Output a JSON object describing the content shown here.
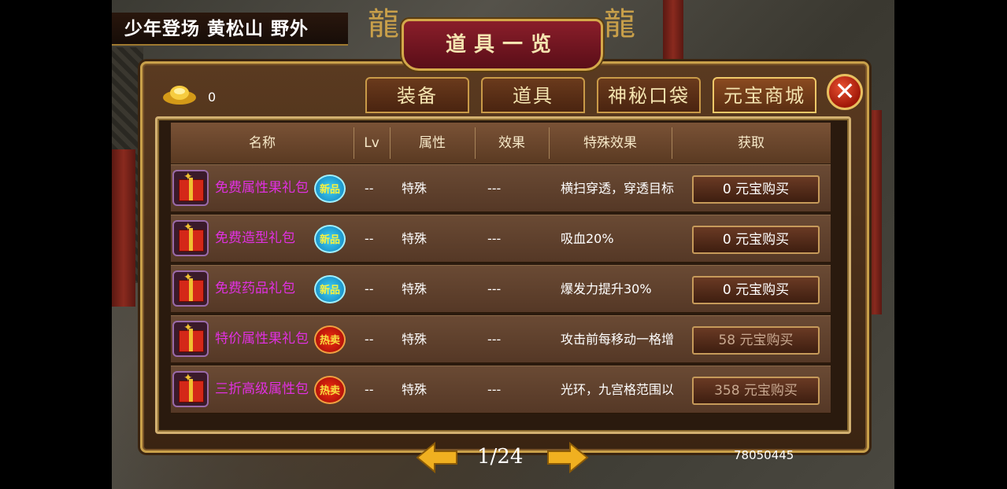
{
  "location": "少年登场 黄松山 野外",
  "window_title": "道具一览",
  "currency": {
    "icon": "gold-ingot-icon",
    "amount": "0"
  },
  "tabs": [
    {
      "label": "装备",
      "active": false
    },
    {
      "label": "道具",
      "active": false
    },
    {
      "label": "神秘口袋",
      "active": false
    },
    {
      "label": "元宝商城",
      "active": true
    }
  ],
  "close_label": "✕",
  "table": {
    "headers": [
      "名称",
      "Lv",
      "属性",
      "效果",
      "特殊效果",
      "获取"
    ],
    "rows": [
      {
        "name": "免费属性果礼包",
        "badge": "新品",
        "badge_type": "new",
        "lv": "--",
        "attr": "特殊",
        "effect": "---",
        "special": "横扫穿透，穿透目标",
        "buy": "0 元宝购买",
        "buy_enabled": true
      },
      {
        "name": "免费造型礼包",
        "badge": "新品",
        "badge_type": "new",
        "lv": "--",
        "attr": "特殊",
        "effect": "---",
        "special": "吸血20%",
        "buy": "0 元宝购买",
        "buy_enabled": true
      },
      {
        "name": "免费药品礼包",
        "badge": "新品",
        "badge_type": "new",
        "lv": "--",
        "attr": "特殊",
        "effect": "---",
        "special": "爆发力提升30%",
        "buy": "0 元宝购买",
        "buy_enabled": true
      },
      {
        "name": "特价属性果礼包",
        "badge": "热卖",
        "badge_type": "hot",
        "lv": "--",
        "attr": "特殊",
        "effect": "---",
        "special": "攻击前每移动一格增",
        "buy": "58 元宝购买",
        "buy_enabled": false
      },
      {
        "name": "三折高级属性包",
        "badge": "热卖",
        "badge_type": "hot",
        "lv": "--",
        "attr": "特殊",
        "effect": "---",
        "special": "光环，九宫格范围以",
        "buy": "358 元宝购买",
        "buy_enabled": false
      }
    ]
  },
  "pagination": {
    "current": "1/24"
  },
  "player_id": "78050445",
  "colors": {
    "item_name": "#e030e0",
    "panel_border": "#c9a04a",
    "title_plate": "#8a1e2a"
  }
}
